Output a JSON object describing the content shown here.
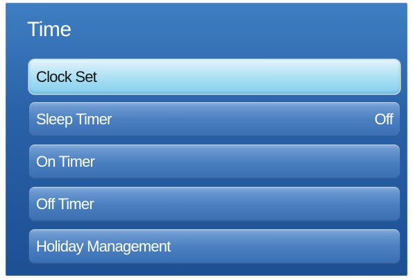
{
  "menu": {
    "title": "Time",
    "items": [
      {
        "label": "Clock Set",
        "value": ""
      },
      {
        "label": "Sleep Timer",
        "value": "Off"
      },
      {
        "label": "On Timer",
        "value": ""
      },
      {
        "label": "Off Timer",
        "value": ""
      },
      {
        "label": "Holiday Management",
        "value": ""
      }
    ],
    "selected_index": 0
  },
  "colors": {
    "panel": "#2a62a8",
    "item_normal": "#4a7fc0",
    "item_selected": "#a8dff3",
    "text_light": "#ffffff",
    "text_dark": "#111111"
  }
}
